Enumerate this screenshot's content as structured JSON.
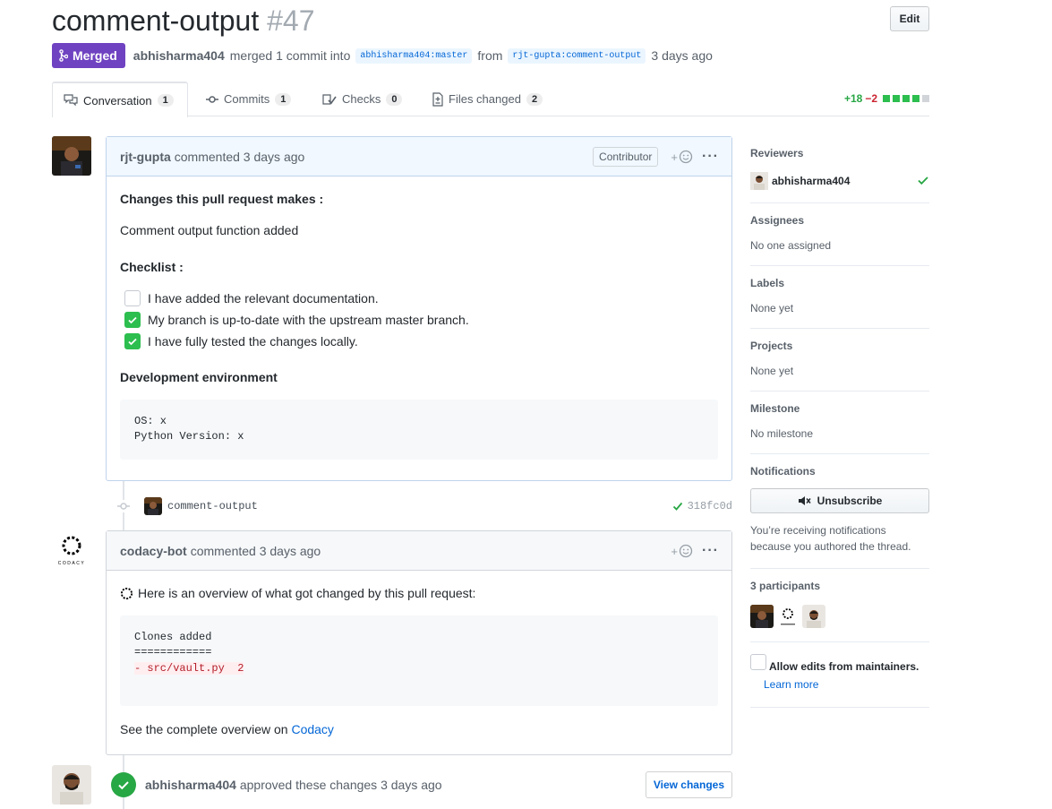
{
  "header": {
    "title": "comment-output",
    "number": "#47",
    "edit_label": "Edit",
    "state_label": "Merged",
    "merger": "abhisharma404",
    "merge_text": "merged 1 commit into",
    "base_branch": "abhisharma404:master",
    "from_text": "from",
    "head_branch": "rjt-gupta:comment-output",
    "time": "3 days ago"
  },
  "tabs": [
    {
      "label": "Conversation",
      "count": "1"
    },
    {
      "label": "Commits",
      "count": "1"
    },
    {
      "label": "Checks",
      "count": "0"
    },
    {
      "label": "Files changed",
      "count": "2"
    }
  ],
  "diffstat": {
    "additions": "+18",
    "deletions": "−2"
  },
  "comment1": {
    "author": "rjt-gupta",
    "action": "commented 3 days ago",
    "role": "Contributor",
    "heading1": "Changes this pull request makes :",
    "para1": "Comment output function added",
    "heading2": "Checklist :",
    "tasks": [
      {
        "label": "I have added the relevant documentation.",
        "checked": false
      },
      {
        "label": "My branch is up-to-date with the upstream master branch.",
        "checked": true
      },
      {
        "label": "I have fully tested the changes locally.",
        "checked": true
      }
    ],
    "heading3": "Development environment",
    "code_line1": "OS: x",
    "code_line2": "Python Version: x"
  },
  "commit": {
    "message": "comment-output",
    "sha": "318fc0d"
  },
  "comment2": {
    "author": "codacy-bot",
    "action": "commented 3 days ago",
    "intro": "Here is an overview of what got changed by this pull request:",
    "code_line1": "Clones added",
    "code_line2": "============",
    "code_line3": "- src/vault.py  2",
    "outro": "See the complete overview on",
    "link": "Codacy",
    "logo_text": "CODACY"
  },
  "review": {
    "author": "abhisharma404",
    "action": "approved these changes 3 days ago",
    "button": "View changes"
  },
  "sidebar": {
    "reviewers_heading": "Reviewers",
    "reviewer": "abhisharma404",
    "assignees_heading": "Assignees",
    "assignees_value": "No one assigned",
    "labels_heading": "Labels",
    "labels_value": "None yet",
    "projects_heading": "Projects",
    "projects_value": "None yet",
    "milestone_heading": "Milestone",
    "milestone_value": "No milestone",
    "notifications_heading": "Notifications",
    "unsubscribe_label": "Unsubscribe",
    "notif_note": "You’re receiving notifications because you authored the thread.",
    "participants_heading": "3 participants",
    "allow_edits_label": "Allow edits from maintainers.",
    "learn_more": "Learn more"
  }
}
